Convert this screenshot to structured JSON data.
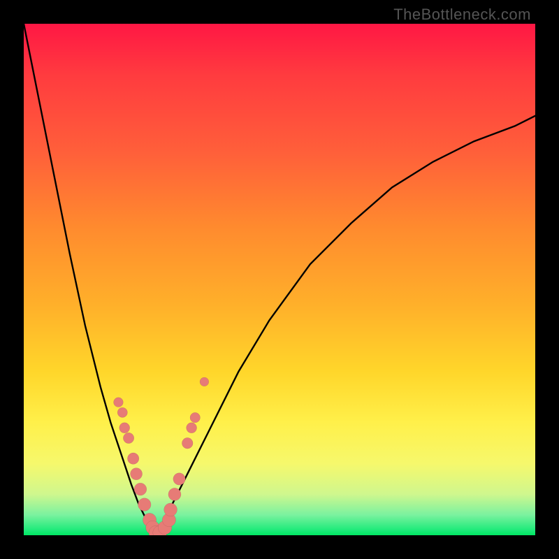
{
  "watermark": "TheBottleneck.com",
  "colors": {
    "frame": "#000000",
    "gradient_top": "#ff1744",
    "gradient_mid": "#ffd62a",
    "gradient_bottom": "#00e863",
    "curve": "#000000",
    "dots": "#e77b76"
  },
  "chart_data": {
    "type": "line",
    "title": "",
    "xlabel": "",
    "ylabel": "",
    "xlim": [
      0,
      1
    ],
    "ylim": [
      0,
      100
    ],
    "series": [
      {
        "name": "left-curve",
        "x": [
          0.0,
          0.03,
          0.06,
          0.09,
          0.12,
          0.15,
          0.17,
          0.19,
          0.21,
          0.225,
          0.24,
          0.252,
          0.258
        ],
        "y": [
          100,
          85,
          70,
          55,
          41,
          29,
          22,
          16,
          10,
          6,
          3,
          1,
          0
        ]
      },
      {
        "name": "right-curve",
        "x": [
          0.258,
          0.27,
          0.29,
          0.32,
          0.36,
          0.42,
          0.48,
          0.56,
          0.64,
          0.72,
          0.8,
          0.88,
          0.96,
          1.0
        ],
        "y": [
          0,
          2,
          6,
          12,
          20,
          32,
          42,
          53,
          61,
          68,
          73,
          77,
          80,
          82
        ]
      }
    ],
    "scatter": {
      "name": "highlight-dots",
      "x": [
        0.185,
        0.193,
        0.197,
        0.205,
        0.214,
        0.22,
        0.228,
        0.236,
        0.246,
        0.252,
        0.258,
        0.266,
        0.276,
        0.284,
        0.287,
        0.295,
        0.304,
        0.32,
        0.328,
        0.335,
        0.353
      ],
      "y": [
        26,
        24,
        21,
        19,
        15,
        12,
        9,
        6,
        3,
        1.5,
        0.5,
        0.5,
        1.5,
        3,
        5,
        8,
        11,
        18,
        21,
        23,
        30
      ]
    }
  }
}
